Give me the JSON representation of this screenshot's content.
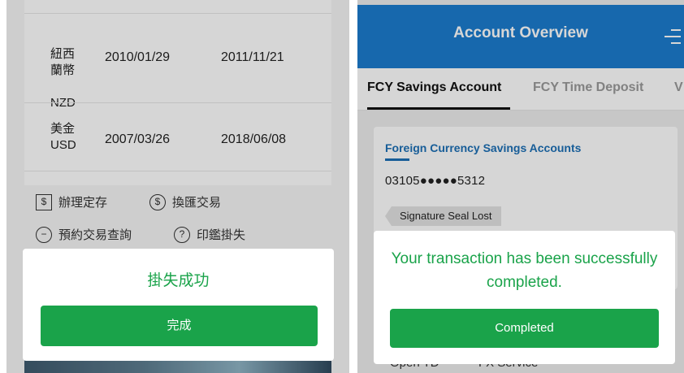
{
  "left": {
    "rates": [
      {
        "currency_zh": "紐西\n蘭幣",
        "currency_code": "NZD",
        "date1": "2010/01/29",
        "date2": "2011/11/21"
      },
      {
        "currency_zh": "美金",
        "currency_code": "USD",
        "date1": "2007/03/26",
        "date2": "2018/06/08"
      }
    ],
    "actions": {
      "open_td": "辦理定存",
      "fx": "換匯交易",
      "reserve_query": "預約交易查詢",
      "seal_lost": "印鑑掛失"
    },
    "dialog": {
      "message": "掛失成功",
      "button": "完成"
    }
  },
  "right": {
    "header": {
      "title": "Account Overview"
    },
    "tabs": [
      {
        "label": "FCY Savings Account",
        "active": true
      },
      {
        "label": "FCY Time Deposit",
        "active": false
      },
      {
        "label": "V",
        "active": false
      }
    ],
    "account": {
      "name": "Foreign Currency Savings Accounts",
      "number": "03105●●●●●5312",
      "tag": "Signature Seal Lost"
    },
    "actions": {
      "open_td": "Open TD",
      "fx": "FX Service"
    },
    "dialog": {
      "message": "Your transaction has been successfully completed.",
      "button": "Completed"
    }
  },
  "colors": {
    "brand_blue": "#1c7ccf",
    "success_green": "#1aa34a"
  },
  "icons": [
    "deposit-icon",
    "exchange-icon",
    "search-icon",
    "help-icon",
    "menu-icon"
  ]
}
